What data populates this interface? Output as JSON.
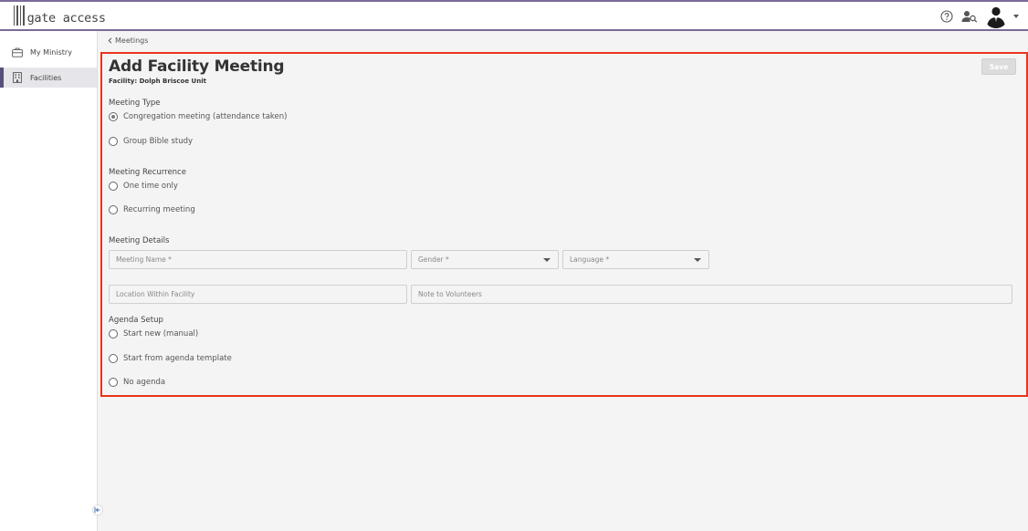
{
  "app": {
    "logo_text": "gate access"
  },
  "colors": {
    "accent": "#5a4f7a",
    "highlight_border": "#e8341c"
  },
  "header": {
    "icons": [
      "help-icon",
      "user-search-icon",
      "avatar",
      "chevron-down-icon"
    ]
  },
  "sidebar": {
    "items": [
      {
        "label": "My Ministry",
        "icon": "briefcase-icon",
        "active": false
      },
      {
        "label": "Facilities",
        "icon": "building-icon",
        "active": true
      }
    ]
  },
  "breadcrumb": {
    "label": "Meetings"
  },
  "page": {
    "title": "Add Facility Meeting",
    "subtitle": "Facility: Dolph Briscoe Unit",
    "save_label": "Save"
  },
  "meeting_type": {
    "label": "Meeting Type",
    "options": [
      {
        "label": "Congregation meeting (attendance taken)",
        "checked": true
      },
      {
        "label": "Group Bible study",
        "checked": false
      }
    ]
  },
  "meeting_recurrence": {
    "label": "Meeting Recurrence",
    "options": [
      {
        "label": "One time only",
        "checked": false
      },
      {
        "label": "Recurring meeting",
        "checked": false
      }
    ]
  },
  "meeting_details": {
    "label": "Meeting Details",
    "meeting_name_placeholder": "Meeting Name *",
    "gender_placeholder": "Gender *",
    "language_placeholder": "Language *",
    "location_placeholder": "Location Within Facility",
    "note_placeholder": "Note to Volunteers"
  },
  "agenda_setup": {
    "label": "Agenda Setup",
    "options": [
      {
        "label": "Start new (manual)",
        "checked": false
      },
      {
        "label": "Start from agenda template",
        "checked": false
      },
      {
        "label": "No agenda",
        "checked": false
      }
    ]
  }
}
